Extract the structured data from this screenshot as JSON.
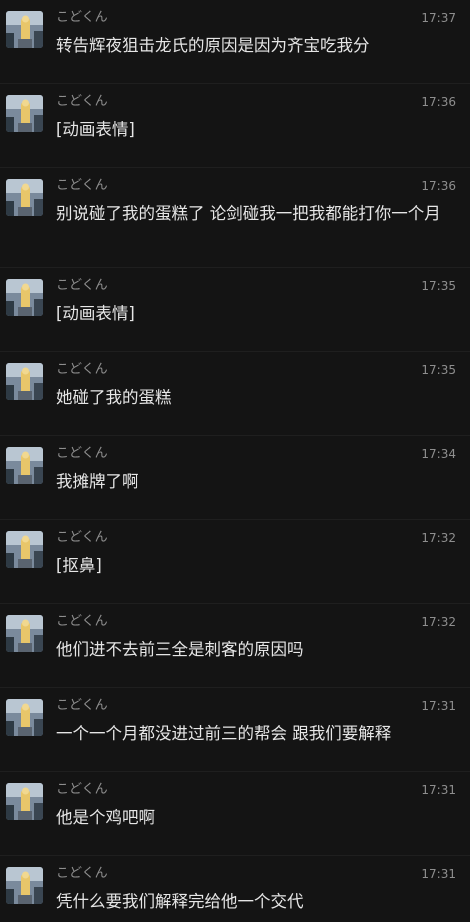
{
  "messages": [
    {
      "name": "こどくん",
      "time": "17:37",
      "text": "转告辉夜狙击龙氏的原因是因为齐宝吃我分"
    },
    {
      "name": "こどくん",
      "time": "17:36",
      "text": "[动画表情]"
    },
    {
      "name": "こどくん",
      "time": "17:36",
      "text": "别说碰了我的蛋糕了 论剑碰我一把我都能打你一个月"
    },
    {
      "name": "こどくん",
      "time": "17:35",
      "text": "[动画表情]"
    },
    {
      "name": "こどくん",
      "time": "17:35",
      "text": "她碰了我的蛋糕"
    },
    {
      "name": "こどくん",
      "time": "17:34",
      "text": "我摊牌了啊"
    },
    {
      "name": "こどくん",
      "time": "17:32",
      "text": "[抠鼻]"
    },
    {
      "name": "こどくん",
      "time": "17:32",
      "text": "他们进不去前三全是刺客的原因吗"
    },
    {
      "name": "こどくん",
      "time": "17:31",
      "text": "一个一个月都没进过前三的帮会 跟我们要解释"
    },
    {
      "name": "こどくん",
      "time": "17:31",
      "text": "他是个鸡吧啊"
    },
    {
      "name": "こどくん",
      "time": "17:31",
      "text": "凭什么要我们解释完给他一个交代"
    }
  ],
  "colors": {
    "background": "#141414",
    "name": "#8e8e8e",
    "time": "#8e8e8e",
    "text": "#e6e6e6",
    "divider": "#1f1f1f"
  }
}
